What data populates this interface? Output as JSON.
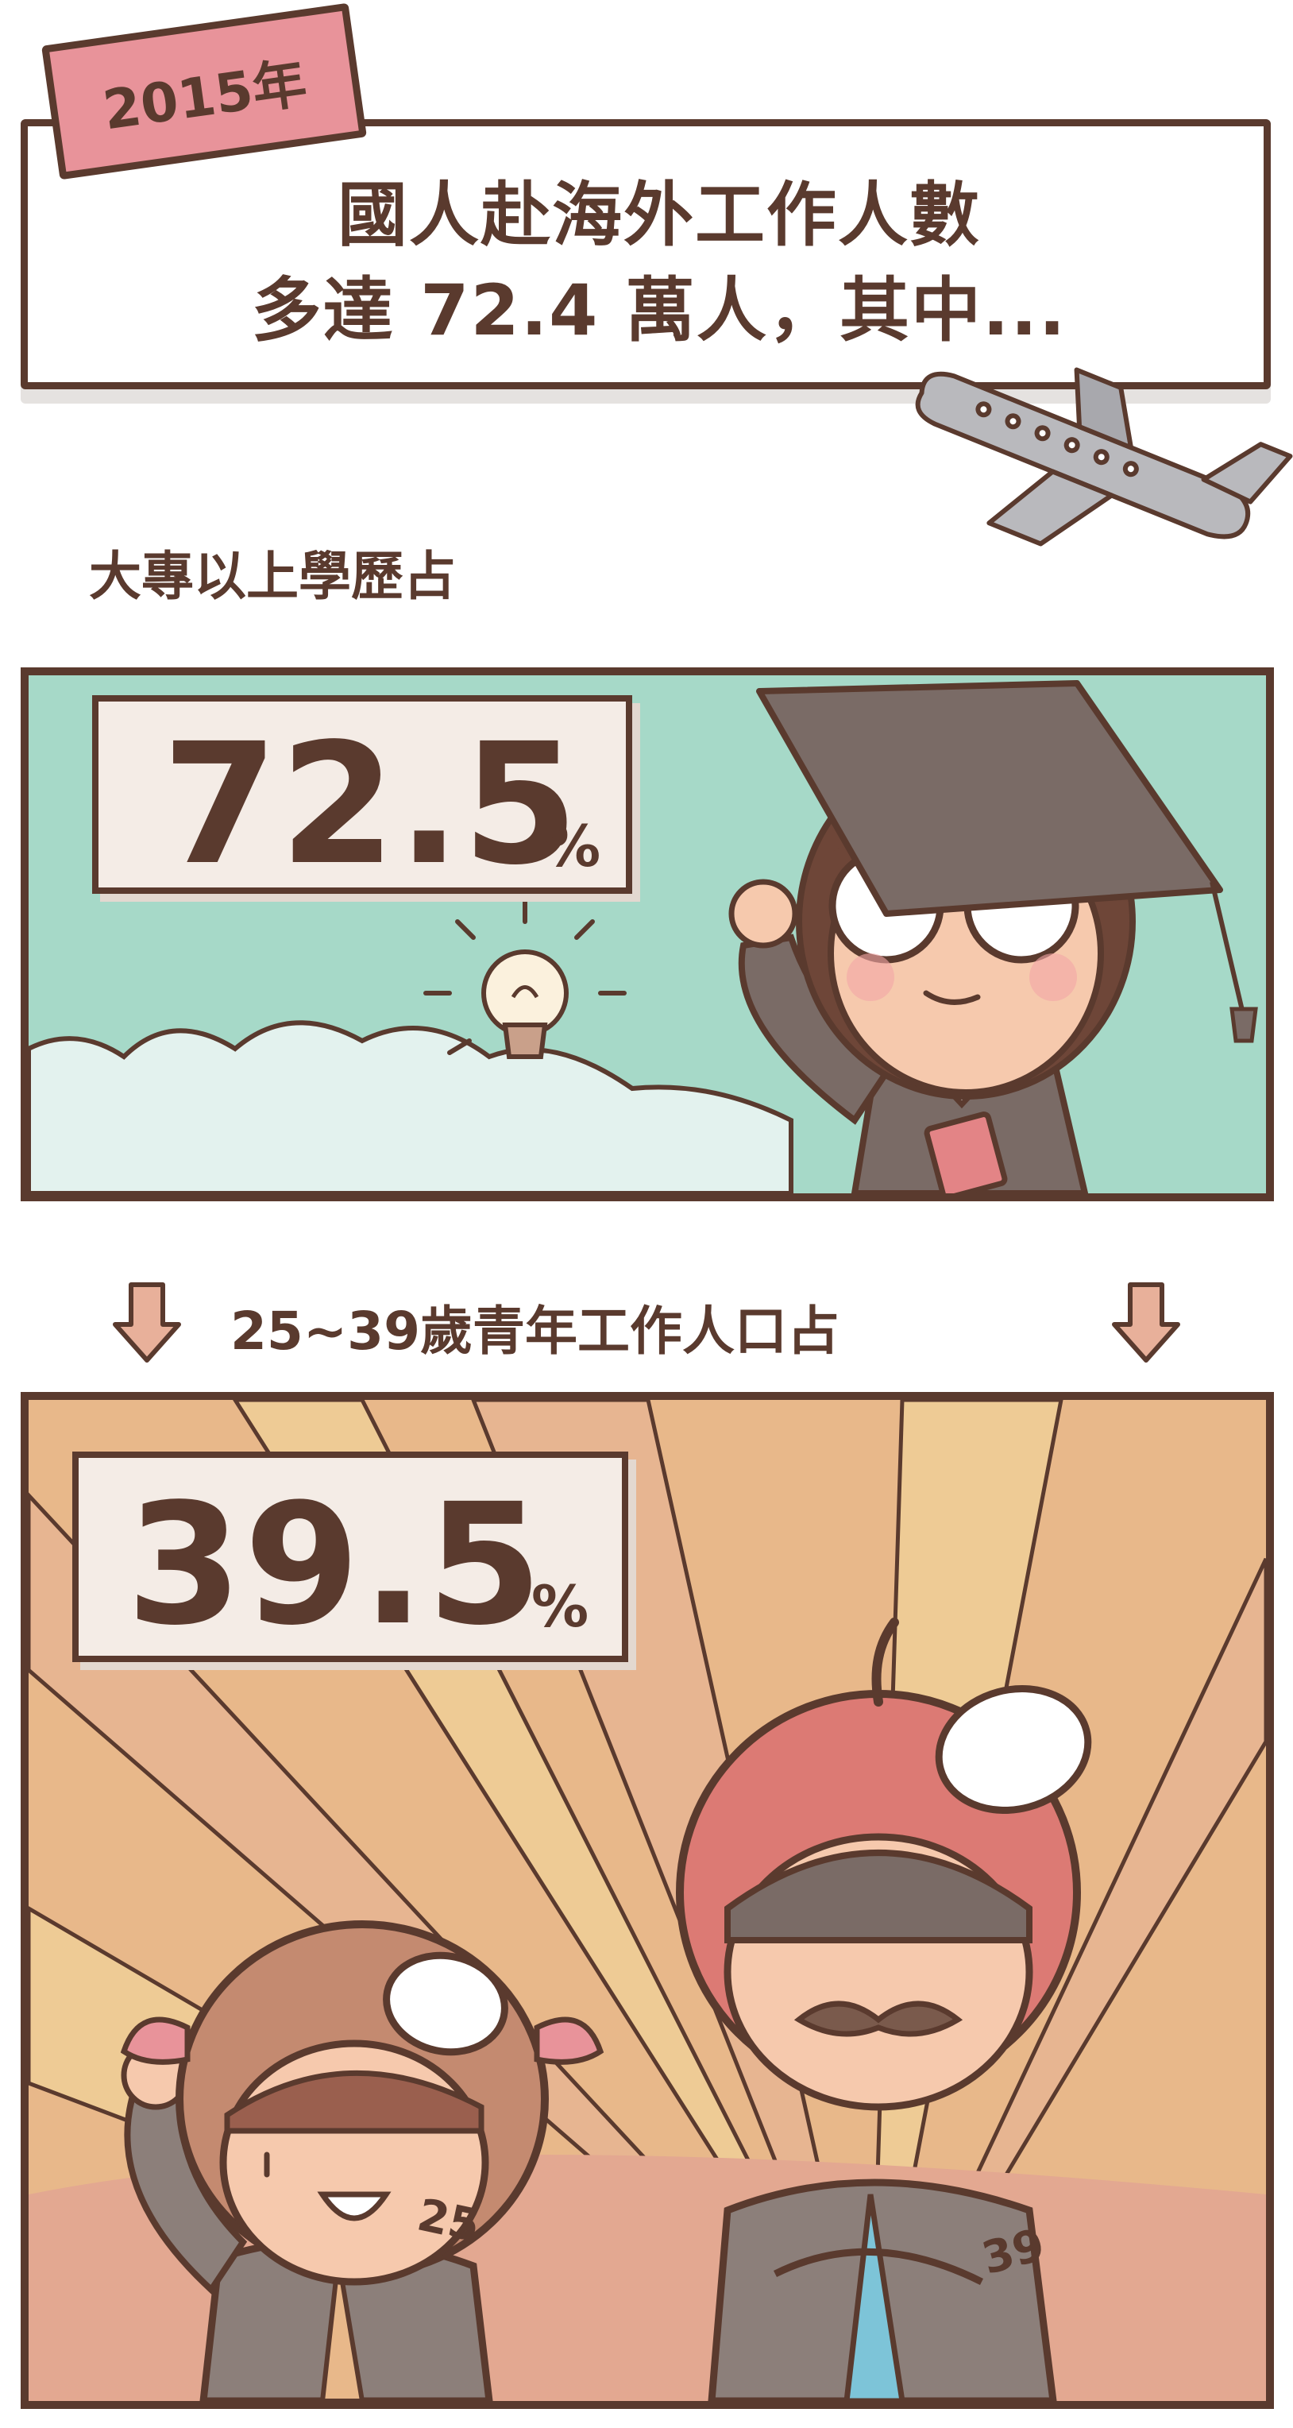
{
  "year_tag": "2015年",
  "headline": {
    "line1": "國人赴海外工作人數",
    "line2": "多達 72.4 萬人，其中..."
  },
  "section1": {
    "heading": "大專以上學歷占",
    "stat_value": "72.5",
    "stat_unit": "%"
  },
  "section2": {
    "heading": "25~39歲青年工作人口占",
    "stat_value": "39.5",
    "stat_unit": "%",
    "badge_left": "25",
    "badge_right": "39"
  },
  "colors": {
    "outline": "#5a3a2e",
    "tag_pink": "#e8939a",
    "panel1_bg": "#a6d9c8",
    "panel2_bg": "#e8b88a",
    "stat_box_bg": "#f4ece6"
  },
  "icons": [
    "airplane-icon",
    "lightbulb-icon",
    "down-arrow-icon"
  ]
}
